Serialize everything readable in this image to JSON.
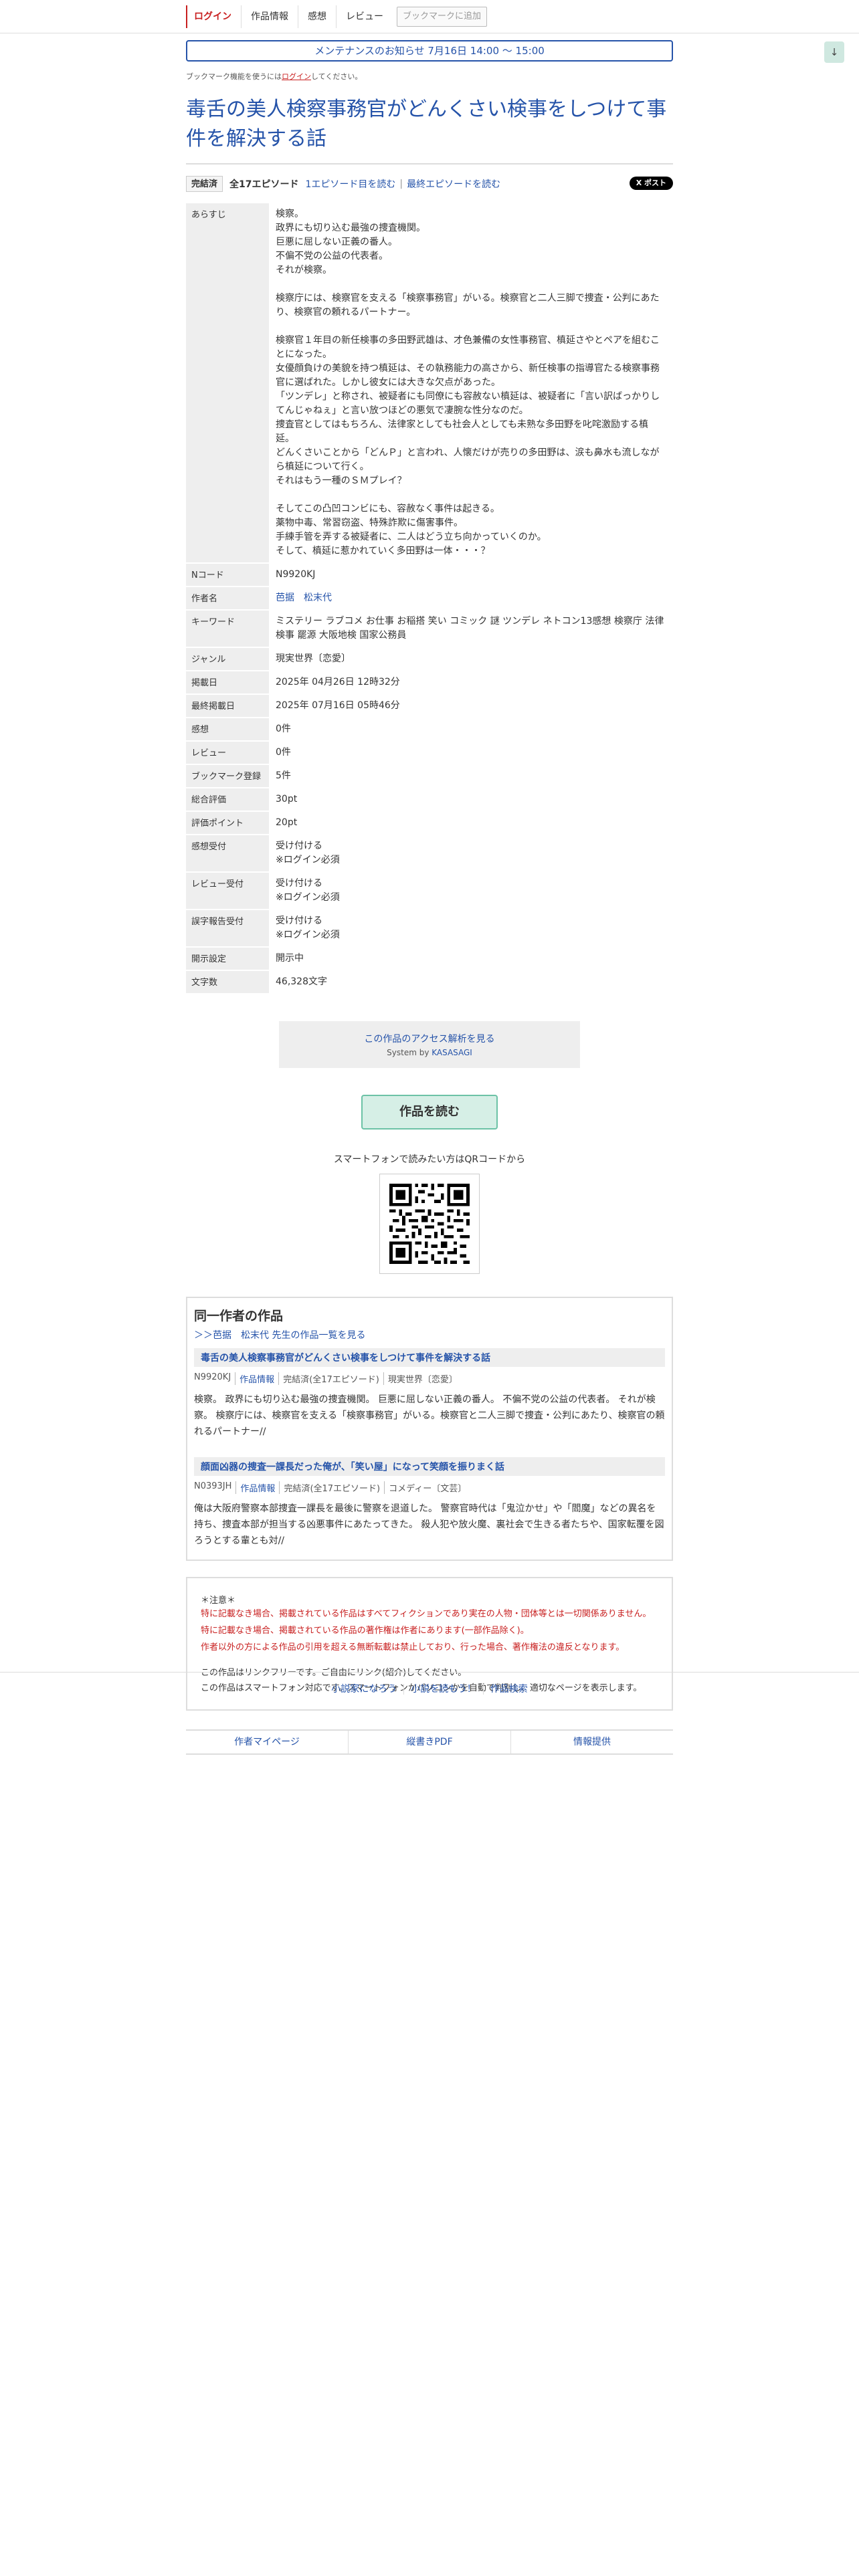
{
  "nav": {
    "login": "ログイン",
    "work_info": "作品情報",
    "impressions": "感想",
    "review": "レビュー",
    "bookmark_add": "ブックマークに追加",
    "scroll_down": "↓"
  },
  "notice": "メンテナンスのお知らせ 7月16日 14:00 ～ 15:00",
  "bookmark_help": {
    "prefix": "ブックマーク機能を使うには",
    "link": "ログイン",
    "suffix": "してください。"
  },
  "title": "毒舌の美人検察事務官がどんくさい検事をしつけて事件を解決する話",
  "episode_row": {
    "status": "完結済",
    "count": "全17エピソード",
    "first": "1エピソード目を読む",
    "separator": "|",
    "latest": "最終エピソードを読む",
    "post": "X ポスト"
  },
  "info": {
    "synopsis_label": "あらすじ",
    "synopsis": [
      "検察。\n政界にも切り込む最強の捜査機関。\n巨悪に屈しない正義の番人。\n不偏不党の公益の代表者。\nそれが検察。",
      "検察庁には、検察官を支える「検察事務官」がいる。検察官と二人三脚で捜査・公判にあたり、検察官の頼れるパートナー。",
      "検察官１年目の新任検事の多田野武雄は、才色兼備の女性事務官、槙延さやとペアを組むことになった。\n女優顔負けの美貌を持つ槙延は、その執務能力の高さから、新任検事の指導官たる検察事務官に選ばれた。しかし彼女には大きな欠点があった。\n「ツンデレ」と称され、被疑者にも同僚にも容赦ない槙延は、被疑者に「言い訳ばっかりしてんじゃねぇ」と言い放つほどの悪気で凄腕な性分なのだ。\n捜査官としてはもちろん、法律家としても社会人としても未熟な多田野を叱咤激励する槙延。\nどんくさいことから「どんＰ」と言われ、人懐だけが売りの多田野は、涙も鼻水も流しながら槙延について行く。\nそれはもう一種のＳＭプレイ？",
      "そしてこの凸凹コンビにも、容赦なく事件は起きる。\n薬物中毒、常習窃盗、特殊詐欺に傷害事件。\n手練手管を弄する被疑者に、二人はどう立ち向かっていくのか。\nそして、槙延に惹かれていく多田野は一体・・・？"
    ],
    "ncode_label": "Nコード",
    "ncode": "N9920KJ",
    "author_label": "作者名",
    "author": "芭据　松末代",
    "keyword_label": "キーワード",
    "keywords": "ミステリー ラブコメ お仕事 お稲搭 笑い コミック 謎 ツンデレ ネトコン13感想 検察庁 法律 検事 罷源 大阪地検 国家公務員",
    "genre_label": "ジャンル",
    "genre": "現実世界〔恋愛〕",
    "published_label": "掲載日",
    "published": "2025年 04月26日 12時32分",
    "updated_label": "最終掲載日",
    "updated": "2025年 07月16日 05時46分",
    "impressions_label": "感想",
    "impressions": "0件",
    "reviews_label": "レビュー",
    "reviews": "0件",
    "bookmarks_label": "ブックマーク登録",
    "bookmarks": "5件",
    "total_label": "総合評価",
    "total": "30pt",
    "rating_label": "評価ポイント",
    "rating": "20pt",
    "accept_imp_label": "感想受付",
    "accept_imp": "受け付ける\n※ログイン必須",
    "accept_rev_label": "レビュー受付",
    "accept_rev": "受け付ける\n※ログイン必須",
    "accept_typo_label": "誤字報告受付",
    "accept_typo": "受け付ける\n※ログイン必須",
    "open_label": "開示設定",
    "open": "開示中",
    "chars_label": "文字数",
    "chars": "46,328文字"
  },
  "kasasagi": {
    "link": "この作品のアクセス解析を見る",
    "system_prefix": "System by ",
    "system_link": "KASASAGI"
  },
  "read_button": "作品を読む",
  "qr_caption": "スマートフォンで読みたい方はQRコードから",
  "same_author": {
    "heading": "同一作者の作品",
    "more": "＞＞芭据　松末代 先生の作品一覧を見る",
    "works": [
      {
        "title": "毒舌の美人検察事務官がどんくさい検事をしつけて事件を解決する話",
        "ncode": "N9920KJ",
        "info": "作品情報",
        "status": "完結済(全17エピソード)",
        "genre": "現実世界〔恋愛〕",
        "summary": "検察。 政界にも切り込む最強の捜査機関。 巨悪に屈しない正義の番人。 不偏不党の公益の代表者。 それが検察。 検察庁には、検察官を支える「検察事務官」がいる。検察官と二人三脚で捜査・公判にあたり、検察官の頼れるパートナー//"
      },
      {
        "title": "顔面凶器の捜査一課長だった俺が、「笑い屋」になって笑顔を振りまく話",
        "ncode": "N0393JH",
        "info": "作品情報",
        "status": "完結済(全17エピソード)",
        "genre": "コメディー〔文芸〕",
        "summary": "俺は大阪府警察本部捜査一課長を最後に警察を退道した。 警察官時代は「鬼泣かせ」や「閻魔」などの異名を持ち、捜査本部が担当する凶悪事件にあたってきた。 殺人犯や放火魔、裏社会で生きる者たちや、国家転覆を図ろうとする輩とも対//"
      }
    ]
  },
  "caution": {
    "heading": "＊注意＊",
    "red": [
      "特に記載なき場合、掲載されている作品はすべてフィクションであり実在の人物・団体等とは一切関係ありません。",
      "特に記載なき場合、掲載されている作品の著作権は作者にあります(一部作品除く)。",
      "作者以外の方による作品の引用を超える無断転載は禁止しており、行った場合、著作権法の違反となります。"
    ],
    "plain": [
      "この作品はリンクフリーです。ご自由にリンク(紹介)してください。",
      "この作品はスマートフォン対応です。スマートフォンかパソコンかを自動で判別し、適切なページを表示します。"
    ]
  },
  "bottom_links": {
    "mypage": "作者マイページ",
    "pdf": "縦書きPDF",
    "report": "情報提供"
  },
  "footer": {
    "site": "小説家になろう",
    "write": "小説を読もう！",
    "search": "作品検索"
  }
}
